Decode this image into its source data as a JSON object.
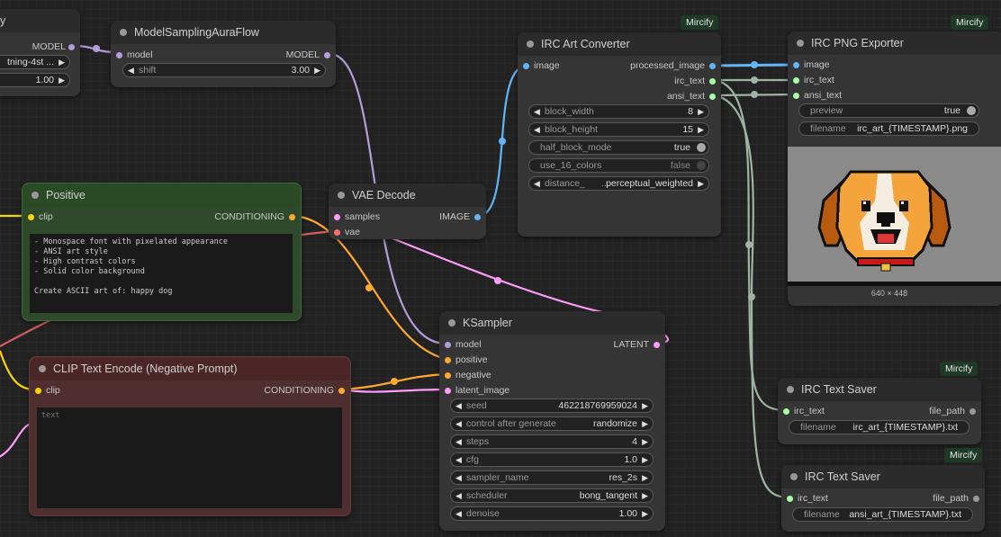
{
  "badge": "Mircify",
  "colors": {
    "clip": "#ffd500",
    "conditioning": "#ffa931",
    "model": "#b39ddb",
    "image": "#64b5f6",
    "latent": "#ff9cf9",
    "vae": "#ff6e6e",
    "text": "#a7ffa7"
  },
  "partial_node": {
    "title": "y",
    "output": "MODEL",
    "widget1_value": "tning-4st ...",
    "widget2_value": "1.00"
  },
  "aura": {
    "title": "ModelSamplingAuraFlow",
    "input": "model",
    "output": "MODEL",
    "shift_label": "shift",
    "shift_value": "3.00"
  },
  "positive": {
    "title": "Positive",
    "input": "clip",
    "output": "CONDITIONING",
    "text": "- Monospace font with pixelated appearance\n- ANSI art style\n- High contrast colors\n- Solid color background\n\nCreate ASCII art of: happy dog"
  },
  "negative": {
    "title": "CLIP Text Encode (Negative Prompt)",
    "input": "clip",
    "output": "CONDITIONING",
    "placeholder": "text"
  },
  "vae": {
    "title": "VAE Decode",
    "inputs": [
      "samples",
      "vae"
    ],
    "output": "IMAGE"
  },
  "irc_conv": {
    "title": "IRC Art Converter",
    "input": "image",
    "outputs": [
      "processed_image",
      "irc_text",
      "ansi_text"
    ],
    "widgets": [
      {
        "label": "block_width",
        "value": "8"
      },
      {
        "label": "block_height",
        "value": "15"
      },
      {
        "label": "half_block_mode",
        "value": "true"
      },
      {
        "label": "use_16_colors",
        "value": "false"
      },
      {
        "label": "distance_",
        "mid": "...",
        "value": "perceptual_weighted"
      }
    ]
  },
  "png_export": {
    "title": "IRC PNG Exporter",
    "inputs": [
      "image",
      "irc_text",
      "ansi_text"
    ],
    "preview_label": "preview",
    "preview_value": "true",
    "filename_label": "filename",
    "filename_value": "irc_art_{TIMESTAMP}.png",
    "image_size": "640 × 448"
  },
  "ksampler": {
    "title": "KSampler",
    "inputs": [
      "model",
      "positive",
      "negative",
      "latent_image"
    ],
    "output": "LATENT",
    "widgets": [
      {
        "label": "seed",
        "value": "462218769959024"
      },
      {
        "label": "control after generate",
        "value": "randomize"
      },
      {
        "label": "steps",
        "value": "4"
      },
      {
        "label": "cfg",
        "value": "1.0"
      },
      {
        "label": "sampler_name",
        "value": "res_2s"
      },
      {
        "label": "scheduler",
        "value": "bong_tangent"
      },
      {
        "label": "denoise",
        "value": "1.00"
      }
    ]
  },
  "saver1": {
    "title": "IRC Text Saver",
    "input": "irc_text",
    "output": "file_path",
    "filename_label": "filename",
    "filename_value": "irc_art_{TIMESTAMP}.txt"
  },
  "saver2": {
    "title": "IRC Text Saver",
    "input": "irc_text",
    "output": "file_path",
    "filename_label": "filename",
    "filename_value": "ansi_art_{TIMESTAMP}.txt"
  }
}
